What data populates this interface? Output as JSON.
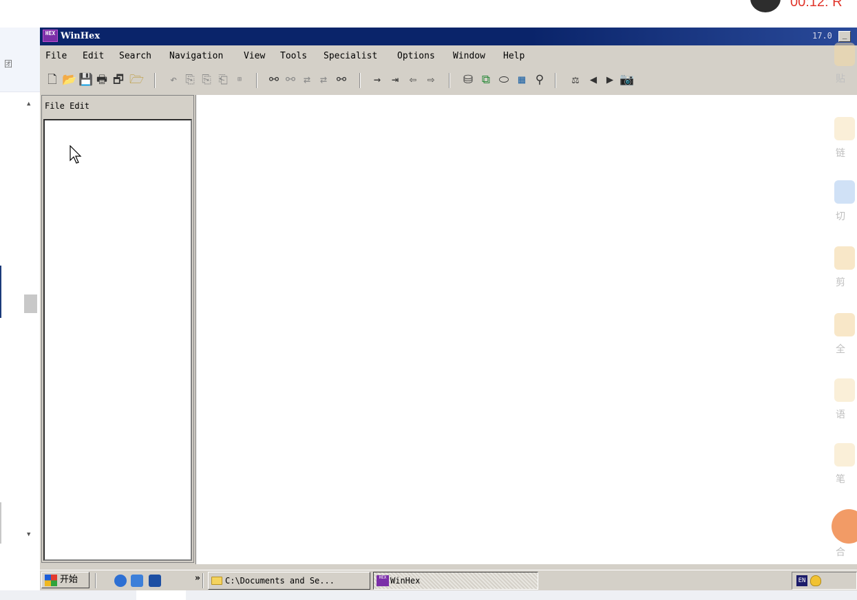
{
  "host": {
    "left_text": "团",
    "recording_text": "00:12: R"
  },
  "window": {
    "title": "WinHex",
    "title_icon_text": "HEX",
    "version": "17.0",
    "min_button": "_"
  },
  "menu": [
    "File",
    "Edit",
    "Search",
    "Navigation",
    "View",
    "Tools",
    "Specialist",
    "Options",
    "Window",
    "Help"
  ],
  "toolbar": {
    "icons": [
      "new-file-icon",
      "open-icon",
      "save-icon",
      "print-icon",
      "properties-icon",
      "open-folder-icon",
      "undo-icon",
      "cut-icon",
      "copy-icon",
      "paste-icon",
      "write-block-icon",
      "find-text-icon",
      "find-hex-icon",
      "replace-text-icon",
      "replace-hex-icon",
      "find-again-icon",
      "goto-offset-icon",
      "goto-page-icon",
      "back-icon",
      "forward-icon",
      "open-disk-icon",
      "clone-disk-icon",
      "ram-icon",
      "calculator-icon",
      "search-files-icon",
      "compare-icon",
      "prev-icon",
      "next-icon",
      "camera-icon"
    ]
  },
  "left_pane": {
    "header": "File Edit"
  },
  "taskbar": {
    "start_label": "开始",
    "chevron": "»",
    "tasks": [
      "C:\\Documents and Se...",
      "WinHex"
    ],
    "lang": "EN"
  },
  "sidebar": {
    "items": [
      "贴",
      "链",
      "切",
      "剪",
      "全",
      "语",
      "笔",
      "合"
    ]
  },
  "colors": {
    "titlebar": "#0a246a",
    "window_face": "#d4d0c8",
    "recording": "#e0352b"
  }
}
